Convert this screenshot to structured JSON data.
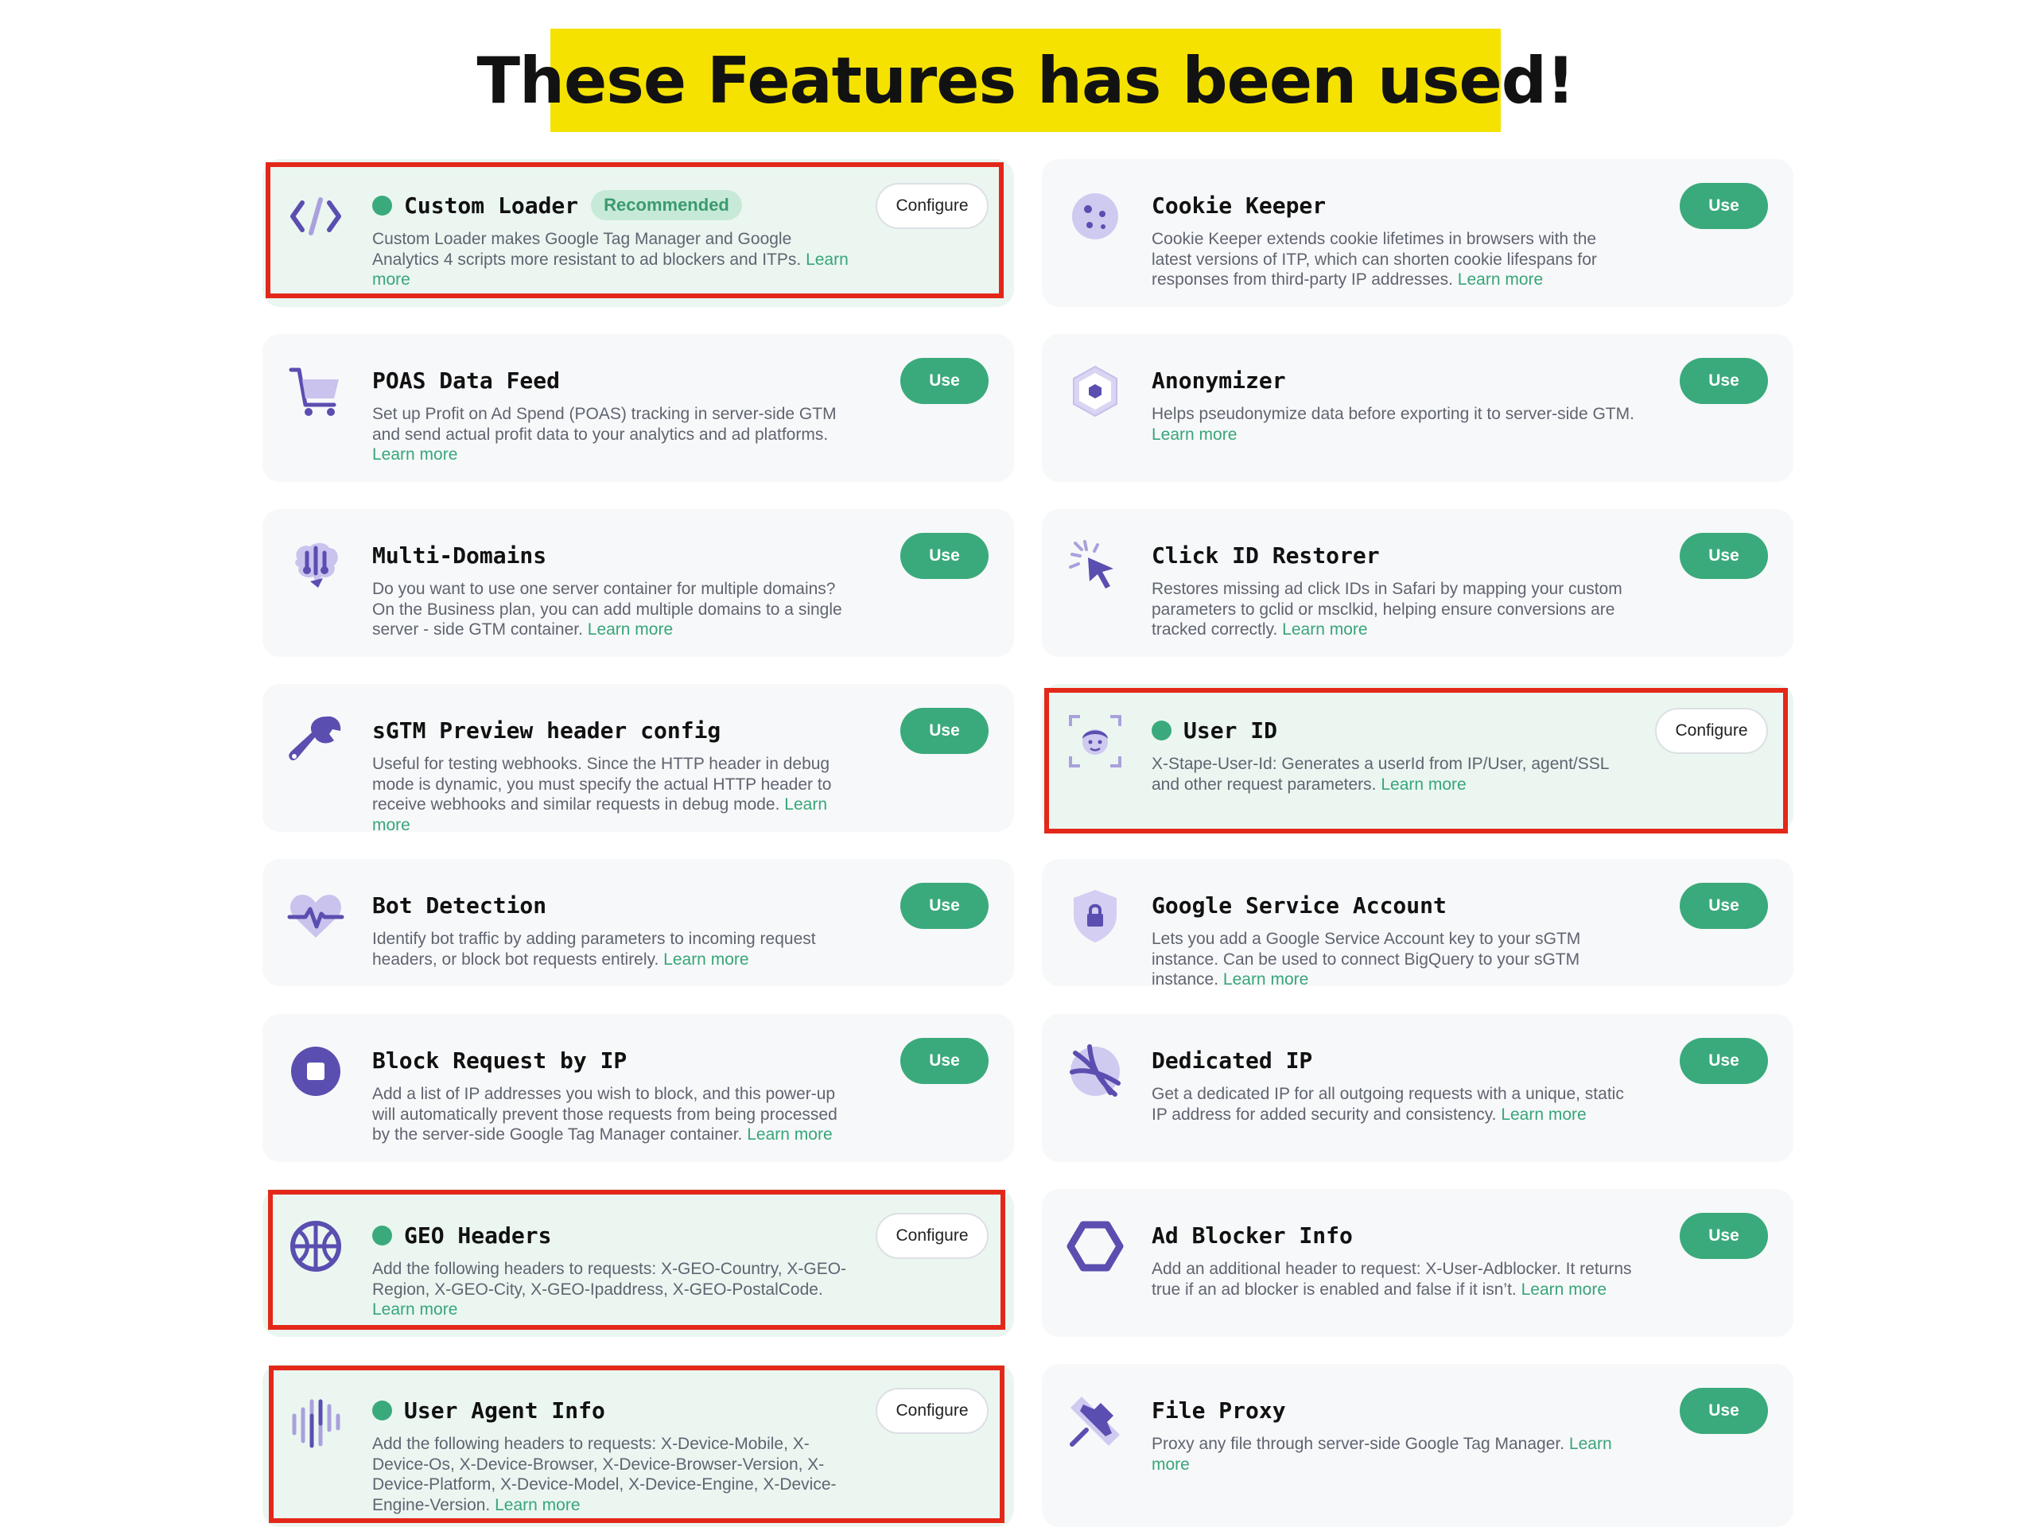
{
  "banner": {
    "title": "These Features has been used!"
  },
  "colors": {
    "accent": "#3aaa7c",
    "active_bg": "#ebf6f1",
    "card_bg": "#f7f8f9",
    "highlight": "#e32819",
    "banner": "#f5e200",
    "icon": "#5a4eb0"
  },
  "features": [
    {
      "title": "Custom Loader",
      "badge": "Recommended",
      "desc": "Custom Loader makes Google Tag Manager and Google Analytics 4 scripts more resistant to ad blockers and ITPs.",
      "learn": "Learn more",
      "action": "Configure",
      "enabled": true,
      "icon": "code-icon"
    },
    {
      "title": "Cookie Keeper",
      "desc": "Cookie Keeper extends cookie lifetimes in browsers with the latest versions of ITP, which can shorten cookie lifespans for responses from third-party IP addresses.",
      "learn": "Learn more",
      "action": "Use",
      "enabled": false,
      "icon": "cookie-icon"
    },
    {
      "title": "POAS Data Feed",
      "desc": "Set up Profit on Ad Spend (POAS) tracking in server-side GTM and send actual profit data to your analytics and ad platforms.",
      "learn": "Learn more",
      "action": "Use",
      "enabled": false,
      "icon": "cart-icon"
    },
    {
      "title": "Anonymizer",
      "desc": "Helps pseudonymize data before exporting it to server-side GTM.",
      "learn": "Learn more",
      "action": "Use",
      "enabled": false,
      "icon": "hexagon-icon"
    },
    {
      "title": "Multi-Domains",
      "desc": "Do you want to use one server container for multiple domains? On the Business plan, you can add multiple domains to a single server - side GTM container.",
      "learn": "Learn more",
      "action": "Use",
      "enabled": false,
      "icon": "brain-icon"
    },
    {
      "title": "Click ID Restorer",
      "desc": "Restores missing ad click IDs in Safari by mapping your custom parameters to gclid or msclkid, helping ensure conversions are tracked correctly.",
      "learn": "Learn more",
      "action": "Use",
      "enabled": false,
      "icon": "cursor-click-icon"
    },
    {
      "title": "sGTM Preview header config",
      "desc": "Useful for testing webhooks. Since the HTTP header in debug mode is dynamic, you must specify the actual HTTP header to receive webhooks and similar requests in debug mode.",
      "learn": "Learn more",
      "action": "Use",
      "enabled": false,
      "icon": "wrench-icon"
    },
    {
      "title": "User ID",
      "desc": "X-Stape-User-Id: Generates a userId from IP/User, agent/SSL and other request parameters.",
      "learn": "Learn more",
      "action": "Configure",
      "enabled": true,
      "icon": "face-scan-icon"
    },
    {
      "title": "Bot Detection",
      "desc": "Identify bot traffic by adding parameters to incoming request headers, or block bot requests entirely.",
      "learn": "Learn more",
      "action": "Use",
      "enabled": false,
      "icon": "heartbeat-icon"
    },
    {
      "title": "Google Service Account",
      "desc": "Lets you add a Google Service Account key to your sGTM instance. Can be used to connect BigQuery to your sGTM instance.",
      "learn": "Learn more",
      "action": "Use",
      "enabled": false,
      "icon": "shield-lock-icon"
    },
    {
      "title": "Block Request by IP",
      "desc": "Add a list of IP addresses you wish to block, and this power-up will automatically prevent those requests from being processed by the server-side Google Tag Manager container.",
      "learn": "Learn more",
      "action": "Use",
      "enabled": false,
      "icon": "stop-icon"
    },
    {
      "title": "Dedicated IP",
      "desc": "Get a dedicated IP for all outgoing requests with a unique, static IP address for added security and consistency.",
      "learn": "Learn more",
      "action": "Use",
      "enabled": false,
      "icon": "satellite-icon"
    },
    {
      "title": "GEO Headers",
      "desc": "Add the following headers to requests: X-GEO-Country, X-GEO-Region, X-GEO-City, X-GEO-Ipaddress, X-GEO-PostalCode.",
      "learn": "Learn more",
      "action": "Configure",
      "enabled": true,
      "icon": "globe-icon"
    },
    {
      "title": "Ad Blocker Info",
      "desc": "Add an additional header to request: X-User-Adblocker. It returns true if an ad blocker is enabled and false if it isn’t.",
      "learn": "Learn more",
      "action": "Use",
      "enabled": false,
      "icon": "hexagon-outline-icon"
    },
    {
      "title": "User Agent Info",
      "desc": "Add the following headers to requests: X-Device-Mobile, X-Device-Os, X-Device-Browser, X-Device-Browser-Version, X-Device-Platform, X-Device-Model, X-Device-Engine, X-Device-Engine-Version.",
      "learn": "Learn more",
      "action": "Configure",
      "enabled": true,
      "icon": "sound-wave-icon"
    },
    {
      "title": "File Proxy",
      "desc": "Proxy any file through server-side Google Tag Manager.",
      "learn": "Learn more",
      "action": "Use",
      "enabled": false,
      "icon": "pin-icon"
    }
  ]
}
